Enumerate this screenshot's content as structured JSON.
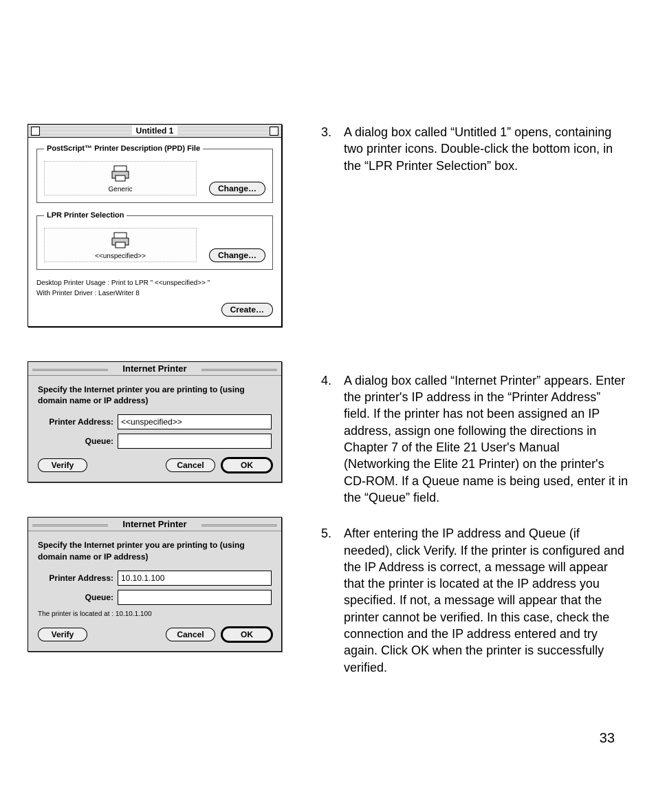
{
  "page_number": "33",
  "dialog1": {
    "title": "Untitled 1",
    "group1": {
      "legend": "PostScript™ Printer Description (PPD) File",
      "icon_label": "Generic",
      "button": "Change…"
    },
    "group2": {
      "legend": "LPR Printer Selection",
      "icon_label": "<<unspecified>>",
      "button": "Change…"
    },
    "usage_line": "Desktop Printer Usage : Print to LPR \" <<unspecified>> \"",
    "driver_line": "With Printer Driver : LaserWriter 8",
    "create_button": "Create…"
  },
  "dialog2": {
    "title": "Internet Printer",
    "instruction": "Specify the Internet printer you are printing to (using domain name or IP address)",
    "addr_label": "Printer Address:",
    "addr_value": "<<unspecified>>",
    "queue_label": "Queue:",
    "queue_value": "",
    "verify": "Verify",
    "cancel": "Cancel",
    "ok": "OK"
  },
  "dialog3": {
    "title": "Internet Printer",
    "instruction": "Specify the Internet printer you are printing to (using domain name or IP address)",
    "addr_label": "Printer Address:",
    "addr_value": "10.10.1.100",
    "queue_label": "Queue:",
    "queue_value": "",
    "status": "The printer is located at : 10.10.1.100",
    "verify": "Verify",
    "cancel": "Cancel",
    "ok": "OK"
  },
  "steps": {
    "s3": {
      "num": "3.",
      "text": "A dialog box called “Untitled 1” opens, containing two printer icons. Double-click the bottom icon, in the “LPR Printer Selection” box."
    },
    "s4": {
      "num": "4.",
      "text": "A dialog box called “Internet Printer” appears. Enter the printer's IP address in the “Printer Address” field. If the printer has not been assigned an IP address, assign one following the directions in Chapter 7 of the Elite 21 User's Manual (Networking the Elite 21 Printer) on the printer's CD-ROM. If a Queue name is being used, enter it in the “Queue” field."
    },
    "s5": {
      "num": "5.",
      "text": "After entering the IP address and Queue (if needed), click Verify. If the printer is configured and the IP Address is correct, a message will appear that the printer is located at the IP address you specified. If not, a message will appear that the printer cannot be verified. In this case, check the connection and the IP address entered and try again. Click OK when the printer is successfully verified."
    }
  }
}
